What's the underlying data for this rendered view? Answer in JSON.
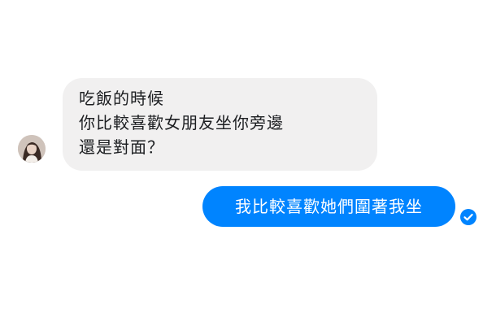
{
  "colors": {
    "incoming_bubble": "#f1f0f0",
    "outgoing_bubble": "#0084ff",
    "incoming_text": "#1c1e21",
    "outgoing_text": "#ffffff"
  },
  "messages": [
    {
      "direction": "incoming",
      "sender_avatar_icon": "profile-photo",
      "lines": [
        "吃飯的時候",
        "你比較喜歡女朋友坐你旁邊",
        "還是對面？"
      ]
    },
    {
      "direction": "outgoing",
      "text": "我比較喜歡她們圍著我坐",
      "status_icon": "check-circle-icon"
    }
  ]
}
